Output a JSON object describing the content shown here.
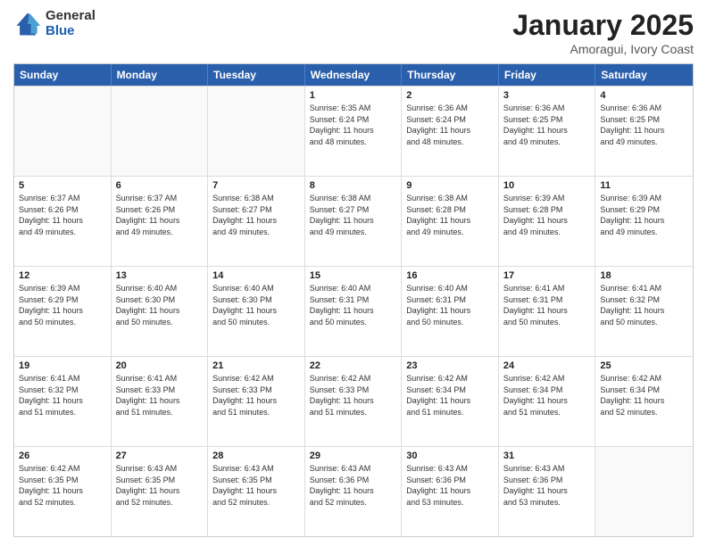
{
  "logo": {
    "general": "General",
    "blue": "Blue"
  },
  "title": {
    "month": "January 2025",
    "location": "Amoragui, Ivory Coast"
  },
  "header": {
    "days": [
      "Sunday",
      "Monday",
      "Tuesday",
      "Wednesday",
      "Thursday",
      "Friday",
      "Saturday"
    ]
  },
  "weeks": [
    [
      {
        "day": "",
        "info": ""
      },
      {
        "day": "",
        "info": ""
      },
      {
        "day": "",
        "info": ""
      },
      {
        "day": "1",
        "info": "Sunrise: 6:35 AM\nSunset: 6:24 PM\nDaylight: 11 hours\nand 48 minutes."
      },
      {
        "day": "2",
        "info": "Sunrise: 6:36 AM\nSunset: 6:24 PM\nDaylight: 11 hours\nand 48 minutes."
      },
      {
        "day": "3",
        "info": "Sunrise: 6:36 AM\nSunset: 6:25 PM\nDaylight: 11 hours\nand 49 minutes."
      },
      {
        "day": "4",
        "info": "Sunrise: 6:36 AM\nSunset: 6:25 PM\nDaylight: 11 hours\nand 49 minutes."
      }
    ],
    [
      {
        "day": "5",
        "info": "Sunrise: 6:37 AM\nSunset: 6:26 PM\nDaylight: 11 hours\nand 49 minutes."
      },
      {
        "day": "6",
        "info": "Sunrise: 6:37 AM\nSunset: 6:26 PM\nDaylight: 11 hours\nand 49 minutes."
      },
      {
        "day": "7",
        "info": "Sunrise: 6:38 AM\nSunset: 6:27 PM\nDaylight: 11 hours\nand 49 minutes."
      },
      {
        "day": "8",
        "info": "Sunrise: 6:38 AM\nSunset: 6:27 PM\nDaylight: 11 hours\nand 49 minutes."
      },
      {
        "day": "9",
        "info": "Sunrise: 6:38 AM\nSunset: 6:28 PM\nDaylight: 11 hours\nand 49 minutes."
      },
      {
        "day": "10",
        "info": "Sunrise: 6:39 AM\nSunset: 6:28 PM\nDaylight: 11 hours\nand 49 minutes."
      },
      {
        "day": "11",
        "info": "Sunrise: 6:39 AM\nSunset: 6:29 PM\nDaylight: 11 hours\nand 49 minutes."
      }
    ],
    [
      {
        "day": "12",
        "info": "Sunrise: 6:39 AM\nSunset: 6:29 PM\nDaylight: 11 hours\nand 50 minutes."
      },
      {
        "day": "13",
        "info": "Sunrise: 6:40 AM\nSunset: 6:30 PM\nDaylight: 11 hours\nand 50 minutes."
      },
      {
        "day": "14",
        "info": "Sunrise: 6:40 AM\nSunset: 6:30 PM\nDaylight: 11 hours\nand 50 minutes."
      },
      {
        "day": "15",
        "info": "Sunrise: 6:40 AM\nSunset: 6:31 PM\nDaylight: 11 hours\nand 50 minutes."
      },
      {
        "day": "16",
        "info": "Sunrise: 6:40 AM\nSunset: 6:31 PM\nDaylight: 11 hours\nand 50 minutes."
      },
      {
        "day": "17",
        "info": "Sunrise: 6:41 AM\nSunset: 6:31 PM\nDaylight: 11 hours\nand 50 minutes."
      },
      {
        "day": "18",
        "info": "Sunrise: 6:41 AM\nSunset: 6:32 PM\nDaylight: 11 hours\nand 50 minutes."
      }
    ],
    [
      {
        "day": "19",
        "info": "Sunrise: 6:41 AM\nSunset: 6:32 PM\nDaylight: 11 hours\nand 51 minutes."
      },
      {
        "day": "20",
        "info": "Sunrise: 6:41 AM\nSunset: 6:33 PM\nDaylight: 11 hours\nand 51 minutes."
      },
      {
        "day": "21",
        "info": "Sunrise: 6:42 AM\nSunset: 6:33 PM\nDaylight: 11 hours\nand 51 minutes."
      },
      {
        "day": "22",
        "info": "Sunrise: 6:42 AM\nSunset: 6:33 PM\nDaylight: 11 hours\nand 51 minutes."
      },
      {
        "day": "23",
        "info": "Sunrise: 6:42 AM\nSunset: 6:34 PM\nDaylight: 11 hours\nand 51 minutes."
      },
      {
        "day": "24",
        "info": "Sunrise: 6:42 AM\nSunset: 6:34 PM\nDaylight: 11 hours\nand 51 minutes."
      },
      {
        "day": "25",
        "info": "Sunrise: 6:42 AM\nSunset: 6:34 PM\nDaylight: 11 hours\nand 52 minutes."
      }
    ],
    [
      {
        "day": "26",
        "info": "Sunrise: 6:42 AM\nSunset: 6:35 PM\nDaylight: 11 hours\nand 52 minutes."
      },
      {
        "day": "27",
        "info": "Sunrise: 6:43 AM\nSunset: 6:35 PM\nDaylight: 11 hours\nand 52 minutes."
      },
      {
        "day": "28",
        "info": "Sunrise: 6:43 AM\nSunset: 6:35 PM\nDaylight: 11 hours\nand 52 minutes."
      },
      {
        "day": "29",
        "info": "Sunrise: 6:43 AM\nSunset: 6:36 PM\nDaylight: 11 hours\nand 52 minutes."
      },
      {
        "day": "30",
        "info": "Sunrise: 6:43 AM\nSunset: 6:36 PM\nDaylight: 11 hours\nand 53 minutes."
      },
      {
        "day": "31",
        "info": "Sunrise: 6:43 AM\nSunset: 6:36 PM\nDaylight: 11 hours\nand 53 minutes."
      },
      {
        "day": "",
        "info": ""
      }
    ]
  ]
}
